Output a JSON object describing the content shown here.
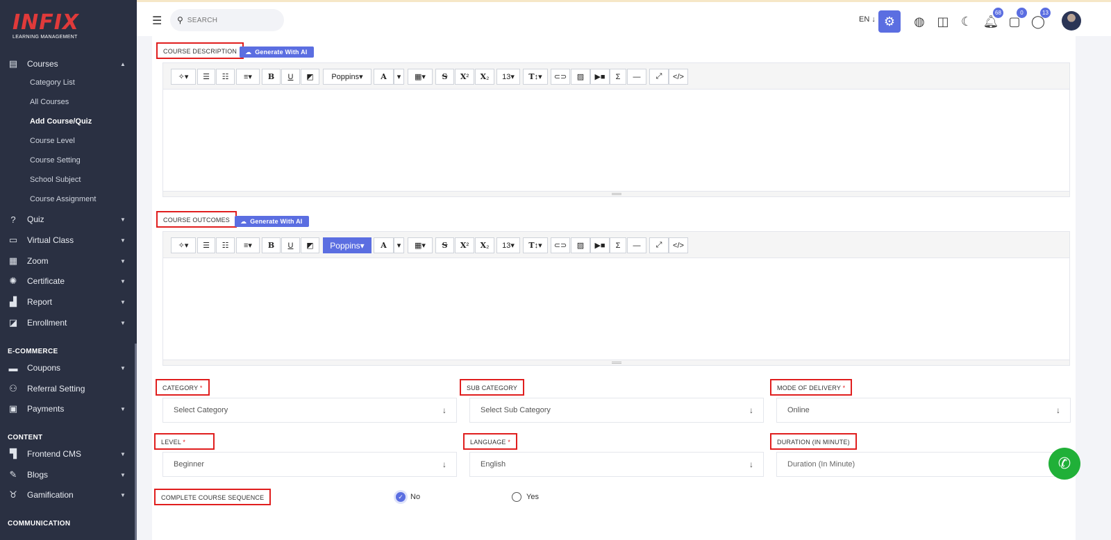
{
  "app": {
    "logo_text": "INFIX",
    "logo_subtitle": "LEARNING MANAGEMENT"
  },
  "sidebar": {
    "courses": {
      "label": "Courses",
      "icon": "book-icon"
    },
    "course_subitems": [
      "Category List",
      "All Courses",
      "Add Course/Quiz",
      "Course Level",
      "Course Setting",
      "School Subject",
      "Course Assignment"
    ],
    "active_subitem": "Add Course/Quiz",
    "items": [
      {
        "label": "Quiz",
        "icon": "question-icon"
      },
      {
        "label": "Virtual Class",
        "icon": "vr-icon"
      },
      {
        "label": "Zoom",
        "icon": "grid-icon"
      },
      {
        "label": "Certificate",
        "icon": "badge-icon"
      },
      {
        "label": "Report",
        "icon": "chart-icon"
      },
      {
        "label": "Enrollment",
        "icon": "enroll-icon"
      }
    ],
    "section_ecommerce": "E-COMMERCE",
    "ecommerce_items": [
      {
        "label": "Coupons",
        "icon": "coupon-icon"
      },
      {
        "label": "Referral Setting",
        "icon": "users-icon"
      },
      {
        "label": "Payments",
        "icon": "money-icon"
      }
    ],
    "section_content": "CONTENT",
    "content_items": [
      {
        "label": "Frontend CMS",
        "icon": "paint-roller-icon"
      },
      {
        "label": "Blogs",
        "icon": "edit-icon"
      },
      {
        "label": "Gamification",
        "icon": "medal-icon"
      }
    ],
    "section_communication": "COMMUNICATION"
  },
  "topbar": {
    "search_placeholder": "SEARCH",
    "language": "EN",
    "notifications_count": "68",
    "messages_count": "0",
    "whatsapp_count": "13"
  },
  "form": {
    "course_description_label": "COURSE DESCRIPTION",
    "course_outcomes_label": "COURSE OUTCOMES",
    "generate_ai_label": "Generate With AI",
    "toolbar": {
      "font": "Poppins",
      "font_size": "13"
    },
    "category": {
      "label": "CATEGORY",
      "value": "Select Category"
    },
    "sub_category": {
      "label": "SUB CATEGORY",
      "value": "Select Sub Category"
    },
    "mode_of_delivery": {
      "label": "MODE OF DELIVERY",
      "value": "Online"
    },
    "level": {
      "label": "LEVEL",
      "value": "Beginner"
    },
    "language": {
      "label": "LANGUAGE",
      "value": "English"
    },
    "duration": {
      "label": "DURATION (IN MINUTE)",
      "placeholder": "Duration (In Minute)"
    },
    "complete_sequence": {
      "label": "COMPLETE COURSE SEQUENCE",
      "option_no": "No",
      "option_yes": "Yes",
      "selected": "No"
    },
    "required_mark": "*"
  },
  "colors": {
    "sidebar_bg": "#2a3042",
    "primary": "#5b6ee1",
    "highlight_border": "#e01e1e",
    "whatsapp": "#20b038"
  }
}
